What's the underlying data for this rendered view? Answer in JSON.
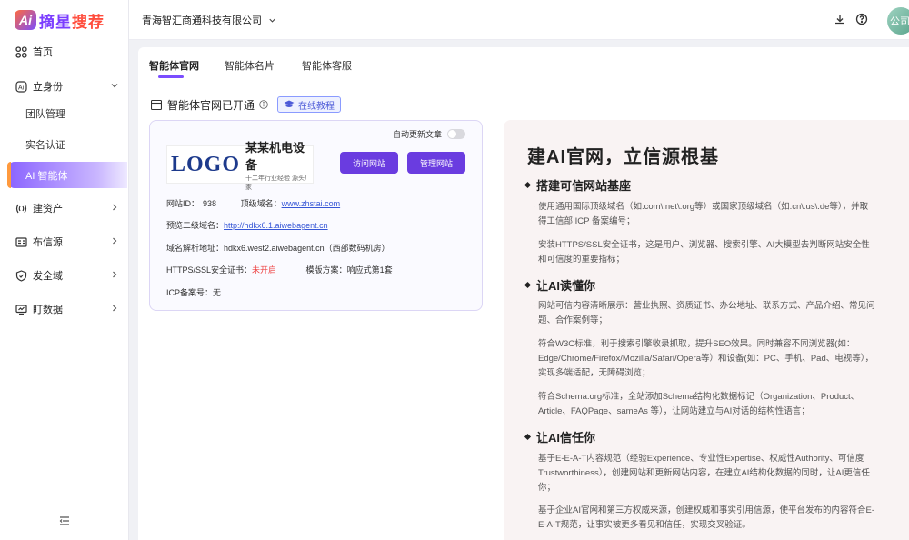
{
  "brand": {
    "mark": "Ai",
    "name_part1": "摘星",
    "name_part2": "搜荐"
  },
  "sidebar": {
    "home": "首页",
    "identity": "立身份",
    "team": "团队管理",
    "realname": "实名认证",
    "agent": "AI 智能体",
    "assets": "建资产",
    "publish": "布信源",
    "security": "发全域",
    "data": "盯数据"
  },
  "header": {
    "company": "青海智汇商通科技有限公司",
    "avatar_text": "公司"
  },
  "tabs": [
    "智能体官网",
    "智能体名片",
    "智能体客服"
  ],
  "section": {
    "title": "智能体官网已开通",
    "tutorial": "在线教程"
  },
  "card": {
    "auto_update": "自动更新文章",
    "logo_big": "LOGO",
    "logo_name": "某某机电设备",
    "logo_sub": "十二年行业经验 源头厂家",
    "visit_btn": "访问网站",
    "manage_btn": "管理网站",
    "site_id_label": "网站ID：",
    "site_id": "938",
    "domain_label": "顶级域名：",
    "domain": "www.zhstai.com",
    "preview_label": "预览二级域名：",
    "preview": "http://hdkx6.1.aiwebagent.cn",
    "dns_label": "域名解析地址：",
    "dns": "hdkx6.west2.aiwebagent.cn（西部数码机房）",
    "ssl_label": "HTTPS/SSL安全证书：",
    "ssl": "未开启",
    "template_label": "模版方案：",
    "template": "响应式第1套",
    "icp_label": "ICP备案号：",
    "icp": "无"
  },
  "panel": {
    "title": "建AI官网，立信源根基",
    "h1": "搭建可信网站基座",
    "p1": "使用通用国际顶级域名（如.com\\.net\\.org等）或国家顶级域名（如.cn\\.us\\.de等），并取得工信部 ICP 备案编号；",
    "p2": "安装HTTPS/SSL安全证书，这是用户、浏览器、搜索引擎、AI大模型去判断网站安全性和可信度的重要指标；",
    "h2": "让AI读懂你",
    "p3": "网站可信内容清晰展示：营业执照、资质证书、办公地址、联系方式、产品介绍、常见问题、合作案例等；",
    "p4": "符合W3C标准，利于搜索引擎收录抓取，提升SEO效果。同时兼容不同浏览器(如：Edge/Chrome/Firefox/Mozilla/Safari/Opera等）和设备(如：PC、手机、Pad、电视等），实现多端适配，无障碍浏览；",
    "p5": "符合Schema.org标准，全站添加Schema结构化数据标记（Organization、Product、Article、FAQPage、sameAs 等），让网站建立与AI对话的结构性语言；",
    "h3": "让AI信任你",
    "p6": "基于E-E-A-T内容规范（经验Experience、专业性Expertise、权威性Authority、可信度Trustworthiness），创建网站和更新网站内容，在建立AI结构化数据的同时，让AI更信任你；",
    "p7": "基于企业AI官网和第三方权威来源，创建权威和事实引用信源，使平台发布的内容符合E-E-A-T规范，让事实被更多看见和信任，实现交叉验证。"
  }
}
